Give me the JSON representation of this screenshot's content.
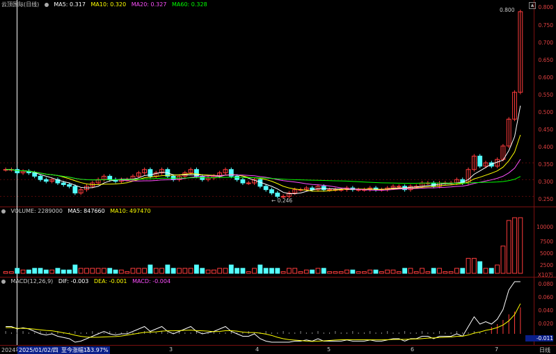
{
  "header": {
    "stock_name": "云顶国际(日线)",
    "ma5": "MA5: 0.317",
    "ma10": "MA10: 0.320",
    "ma20": "MA20: 0.327",
    "ma60": "MA60: 0.328",
    "last_price_marker": "0.800"
  },
  "volume_legend": {
    "volume": "VOLUME: 2289000",
    "ma5": "MA5: 847660",
    "ma10": "MA10: 497470"
  },
  "macd_legend": {
    "label": "MACD(12,26,9)",
    "dif": "DIF: -0.003",
    "dea": "DEA: -0.001",
    "macd": "MACD: -0.004"
  },
  "price_axis": [
    "0.800",
    "0.750",
    "0.700",
    "0.650",
    "0.600",
    "0.550",
    "0.500",
    "0.450",
    "0.400",
    "0.350",
    "0.300",
    "0.250"
  ],
  "volume_axis": [
    "10000",
    "7500",
    "5000",
    "2500",
    "X10万"
  ],
  "macd_axis": [
    "0.080",
    "0.060",
    "0.040",
    "0.020",
    "-0.011"
  ],
  "low_marker": "← 0.246",
  "bottom_bar": {
    "year": "2024年",
    "date": "2025/01/02/四",
    "change": "至今涨幅153.97%",
    "period": "日线",
    "months": [
      "2",
      "3",
      "4",
      "5",
      "6",
      "7"
    ]
  },
  "colors": {
    "up": "#ff3c3c",
    "down": "#54ffff",
    "ma5": "#ffffff",
    "ma10": "#ffff00",
    "ma20": "#ff50ff",
    "ma60": "#00ff00",
    "frame": "#7a1010"
  },
  "chart_data": {
    "type": "candlestick",
    "title": "云顶国际(日线)",
    "price_range": [
      0.23,
      0.81
    ],
    "closes": [
      0.33,
      0.33,
      0.32,
      0.325,
      0.32,
      0.31,
      0.3,
      0.295,
      0.3,
      0.29,
      0.285,
      0.28,
      0.26,
      0.27,
      0.28,
      0.29,
      0.3,
      0.31,
      0.3,
      0.295,
      0.3,
      0.3,
      0.31,
      0.32,
      0.33,
      0.31,
      0.32,
      0.33,
      0.31,
      0.3,
      0.31,
      0.32,
      0.33,
      0.31,
      0.3,
      0.305,
      0.31,
      0.32,
      0.33,
      0.31,
      0.3,
      0.29,
      0.29,
      0.3,
      0.28,
      0.27,
      0.26,
      0.25,
      0.25,
      0.26,
      0.27,
      0.27,
      0.275,
      0.27,
      0.28,
      0.27,
      0.27,
      0.27,
      0.27,
      0.275,
      0.27,
      0.27,
      0.27,
      0.275,
      0.27,
      0.27,
      0.275,
      0.28,
      0.28,
      0.27,
      0.28,
      0.28,
      0.29,
      0.29,
      0.28,
      0.29,
      0.29,
      0.29,
      0.3,
      0.29,
      0.33,
      0.37,
      0.34,
      0.35,
      0.34,
      0.36,
      0.4,
      0.48,
      0.56,
      0.8
    ]
  }
}
